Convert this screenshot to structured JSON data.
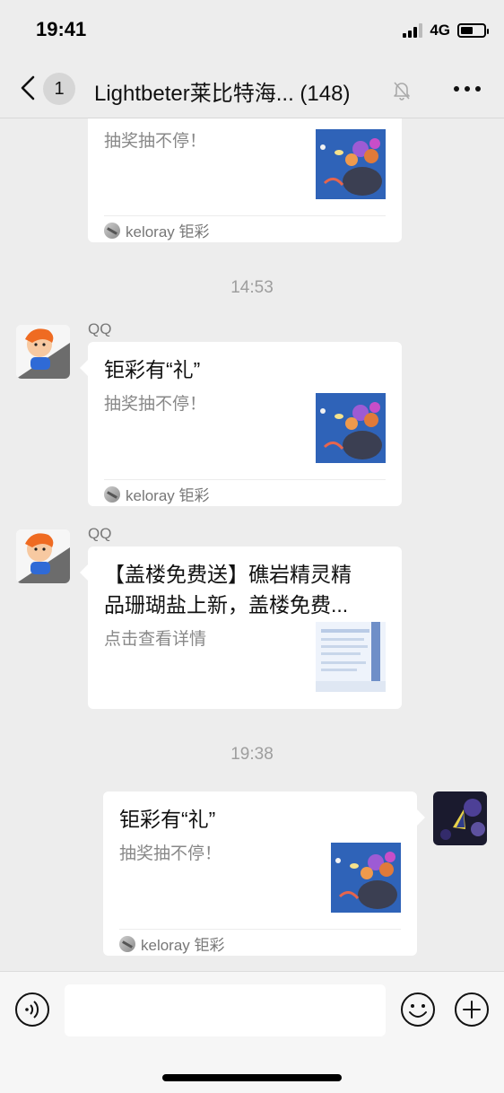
{
  "status_bar": {
    "time": "19:41",
    "network": "4G",
    "battery_level": 0.55
  },
  "nav": {
    "unread_count": "1",
    "title": "Lightbeter莱比特海...",
    "member_count": "(148)",
    "icons": [
      "chevron-left-icon",
      "bell-muted-icon",
      "more-icon"
    ]
  },
  "messages": [
    {
      "type": "link-card",
      "side": "left",
      "desc": "抽奖抽不停！",
      "source": "keloray 钜彩",
      "thumb": "coral-reef-thumbnail"
    },
    {
      "type": "time",
      "text": "14:53"
    },
    {
      "type": "link-card",
      "side": "left",
      "sender": "QQ",
      "title": "钜彩有“礼”",
      "desc": "抽奖抽不停！",
      "source": "keloray 钜彩",
      "thumb": "coral-reef-thumbnail"
    },
    {
      "type": "link-card",
      "side": "left",
      "sender": "QQ",
      "title_line1": "【盖楼免费送】礁岩精灵精",
      "title_line2": "品珊瑚盐上新，盖楼免费...",
      "desc": "点击查看详情",
      "thumb": "article-thumbnail"
    },
    {
      "type": "time",
      "text": "19:38"
    },
    {
      "type": "link-card",
      "side": "right",
      "title": "钜彩有“礼”",
      "desc": "抽奖抽不停！",
      "source": "keloray 钜彩",
      "thumb": "coral-reef-thumbnail"
    }
  ],
  "input_bar": {
    "placeholder": "",
    "icons": [
      "voice-icon",
      "emoji-icon",
      "plus-icon"
    ]
  },
  "colors": {
    "background": "#ededed",
    "bubble": "#ffffff",
    "secondary_text": "#888888",
    "time_text": "#9e9e9e"
  }
}
